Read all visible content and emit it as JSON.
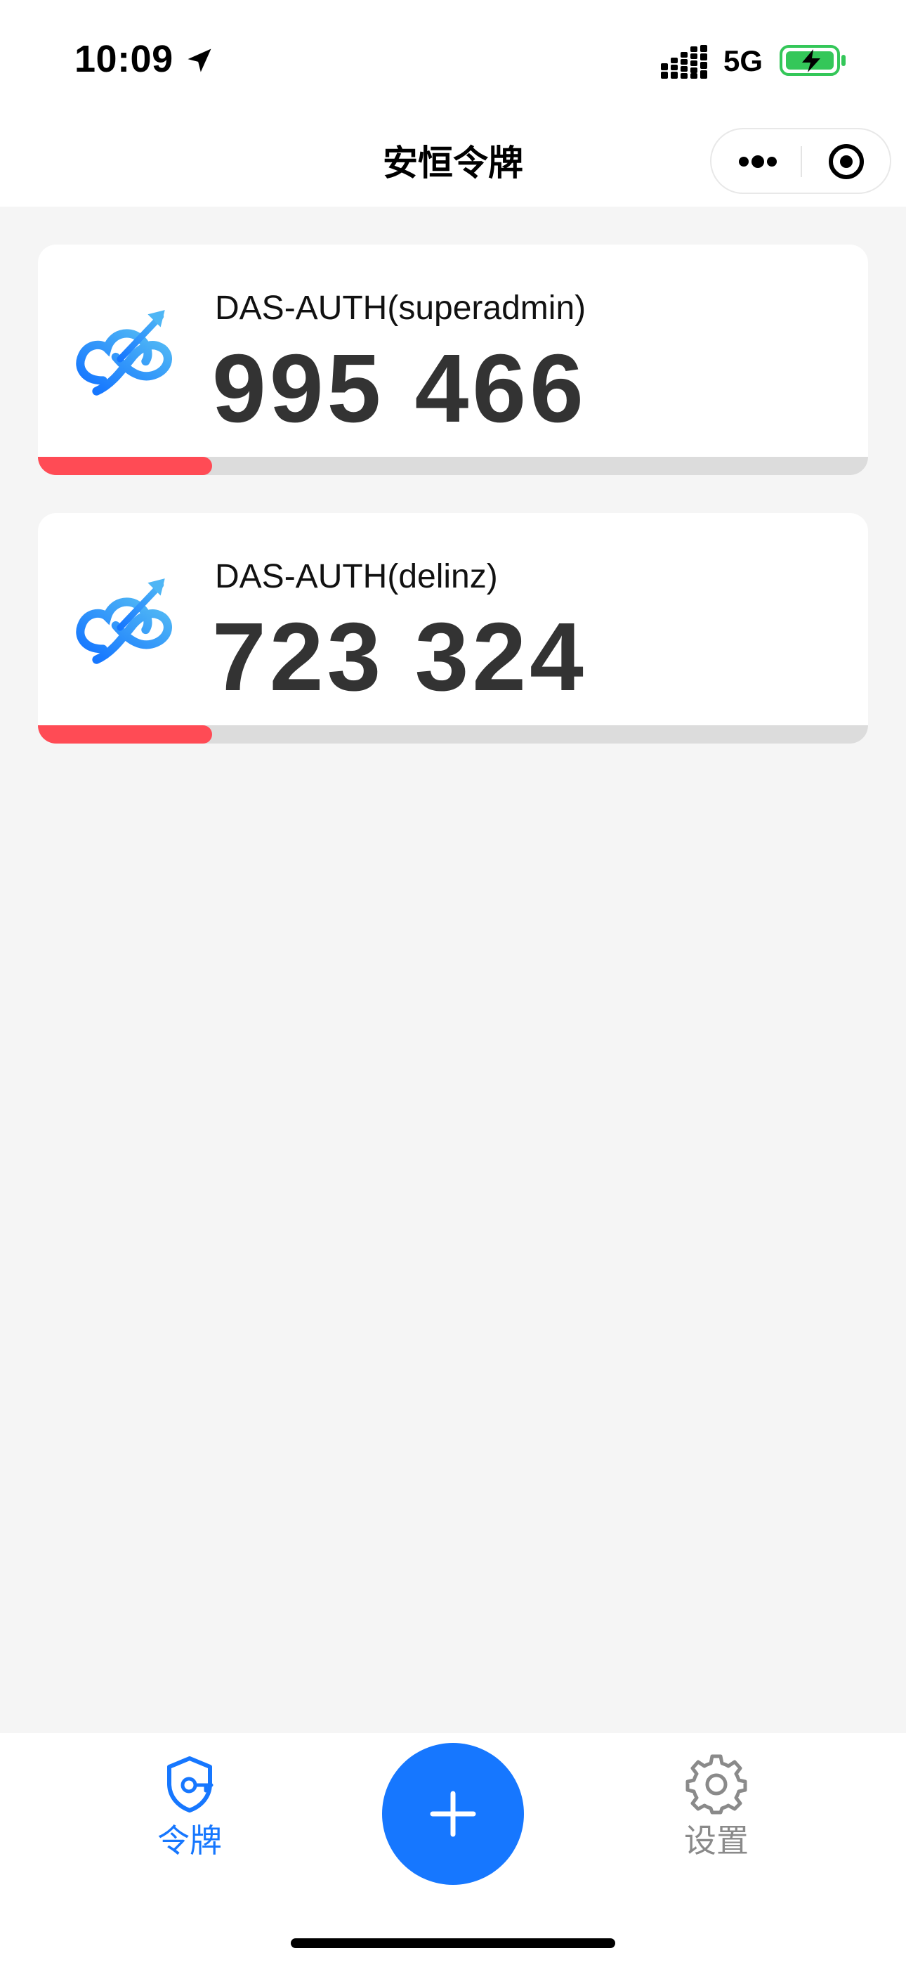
{
  "status_bar": {
    "time": "10:09",
    "network": "5G",
    "icons": [
      "location-arrow-icon",
      "cellular-signal-icon",
      "battery-charging-icon"
    ]
  },
  "nav": {
    "title": "安恒令牌",
    "capsule_icons": [
      "more-dots-icon",
      "close-target-icon"
    ]
  },
  "tokens": [
    {
      "name": "DAS-AUTH(superadmin)",
      "code": "995 466",
      "remaining_fraction": 0.21,
      "logo": "cloud-infinity-logo"
    },
    {
      "name": "DAS-AUTH(delinz)",
      "code": "723 324",
      "remaining_fraction": 0.21,
      "logo": "cloud-infinity-logo"
    }
  ],
  "tab_bar": {
    "tokens_label": "令牌",
    "settings_label": "设置",
    "add_icon": "plus-icon",
    "tokens_icon": "shield-key-icon",
    "settings_icon": "gear-icon"
  },
  "colors": {
    "accent": "#1677ff",
    "progress": "#ff4b55",
    "progress_track": "#dcdcdc",
    "code_text": "#333333",
    "inactive_tab": "#8a8a8a",
    "background": "#f5f5f5",
    "battery_fill": "#34c759"
  }
}
